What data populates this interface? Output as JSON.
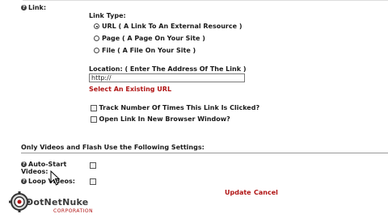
{
  "link_section": {
    "label": "Link:",
    "link_type_label": "Link Type:",
    "options": [
      {
        "label": "URL ( A Link To An External Resource )",
        "selected": true
      },
      {
        "label": "Page ( A Page On Your Site )",
        "selected": false
      },
      {
        "label": "File ( A File On Your Site )",
        "selected": false
      }
    ],
    "location_label": "Location: ( Enter The Address Of The Link )",
    "location_value": "http://",
    "select_existing_url": "Select An Existing URL",
    "track_clicks_label": "Track Number Of Times This Link Is Clicked?",
    "new_window_label": "Open Link In New Browser Window?"
  },
  "video_section": {
    "heading": "Only Videos and Flash Use the Following Settings:",
    "auto_start_label": "Auto-Start Videos:",
    "loop_videos_label": "Loop Videos:"
  },
  "actions": {
    "update": "Update",
    "cancel": "Cancel"
  },
  "logo": {
    "name": "DotNetNuke",
    "subtitle": "CORPORATION"
  },
  "colors": {
    "link_red": "#b01414"
  }
}
